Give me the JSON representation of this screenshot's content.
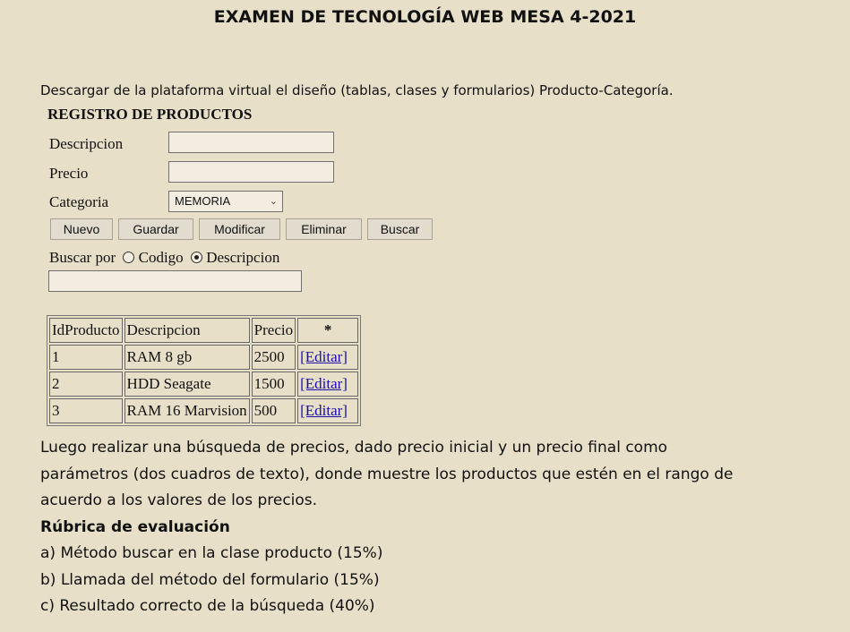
{
  "document": {
    "title": "EXAMEN DE TECNOLOGÍA WEB MESA 4-2021",
    "intro": "Descargar de la plataforma virtual el diseño (tablas, clases y formularios) Producto-Categoría."
  },
  "form": {
    "title": "REGISTRO DE PRODUCTOS",
    "descripcion_label": "Descripcion",
    "descripcion_value": "",
    "precio_label": "Precio",
    "precio_value": "",
    "categoria_label": "Categoria",
    "categoria_selected": "MEMORIA",
    "buttons": {
      "nuevo": "Nuevo",
      "guardar": "Guardar",
      "modificar": "Modificar",
      "eliminar": "Eliminar",
      "buscar": "Buscar"
    },
    "search_by_label": "Buscar por",
    "radio_codigo": "Codigo",
    "radio_descripcion": "Descripcion",
    "radio_selected": "Descripcion",
    "search_value": ""
  },
  "table": {
    "headers": [
      "IdProducto",
      "Descripcion",
      "Precio",
      "*"
    ],
    "rows": [
      {
        "id": "1",
        "descripcion": "RAM 8 gb",
        "precio": "2500",
        "action": "[Editar]"
      },
      {
        "id": "2",
        "descripcion": "HDD Seagate",
        "precio": "1500",
        "action": "[Editar]"
      },
      {
        "id": "3",
        "descripcion": "RAM 16 Marvision",
        "precio": "500",
        "action": "[Editar]"
      }
    ]
  },
  "instructions": {
    "line1": "Luego realizar una búsqueda de precios, dado precio inicial y un precio final como",
    "line2": "parámetros (dos cuadros de texto), donde muestre los productos que estén en el rango de",
    "line3": "acuerdo a los valores de los precios.",
    "rubric_title": "Rúbrica de evaluación",
    "rubric": [
      "a) Método buscar en la clase producto (15%)",
      "b) Llamada del método del formulario (15%)",
      "c) Resultado correcto de la búsqueda (40%)"
    ]
  }
}
